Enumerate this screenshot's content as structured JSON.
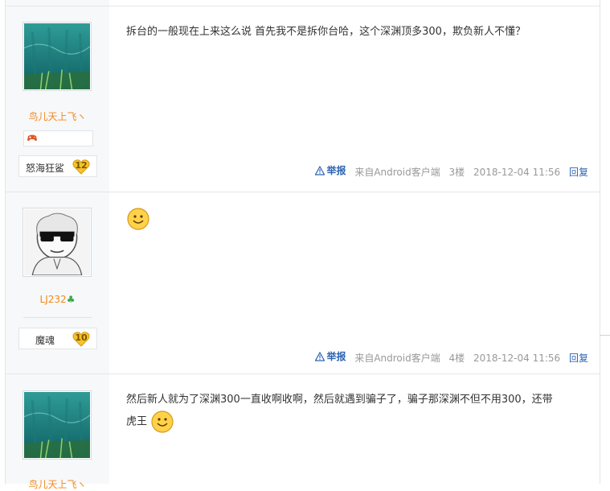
{
  "posts": [
    {
      "username": "鸟儿天上飞ヽ",
      "level_name": "怒海狂鲨",
      "level_num": "12",
      "text": "拆台的一般现在上来这么说 首先我不是拆你台哈，这个深渊顶多300，欺负新人不懂？",
      "report_label": "举报",
      "client": "来自Android客户端",
      "floor": "3楼",
      "time": "2018-12-04 11:56",
      "reply_label": "回复",
      "avatar_icon": "teal-forest-avatar"
    },
    {
      "username": "LJ232",
      "level_name": "魔魂",
      "level_num": "10",
      "text": "",
      "report_label": "举报",
      "client": "来自Android客户端",
      "floor": "4楼",
      "time": "2018-12-04 11:56",
      "reply_label": "回复",
      "avatar_icon": "sunglasses-meme-avatar"
    },
    {
      "username": "鸟儿天上飞ヽ",
      "text_line1": "然后新人就为了深渊300一直收啊收啊，然后就遇到骗子了，骗子那深渊不但不用300，还带",
      "text_line2": "虎王",
      "avatar_icon": "teal-forest-avatar"
    }
  ],
  "colors": {
    "username": "#f08a1e",
    "link": "#2d64b3",
    "meta": "#999999",
    "sidebar": "#f7f8fa"
  }
}
